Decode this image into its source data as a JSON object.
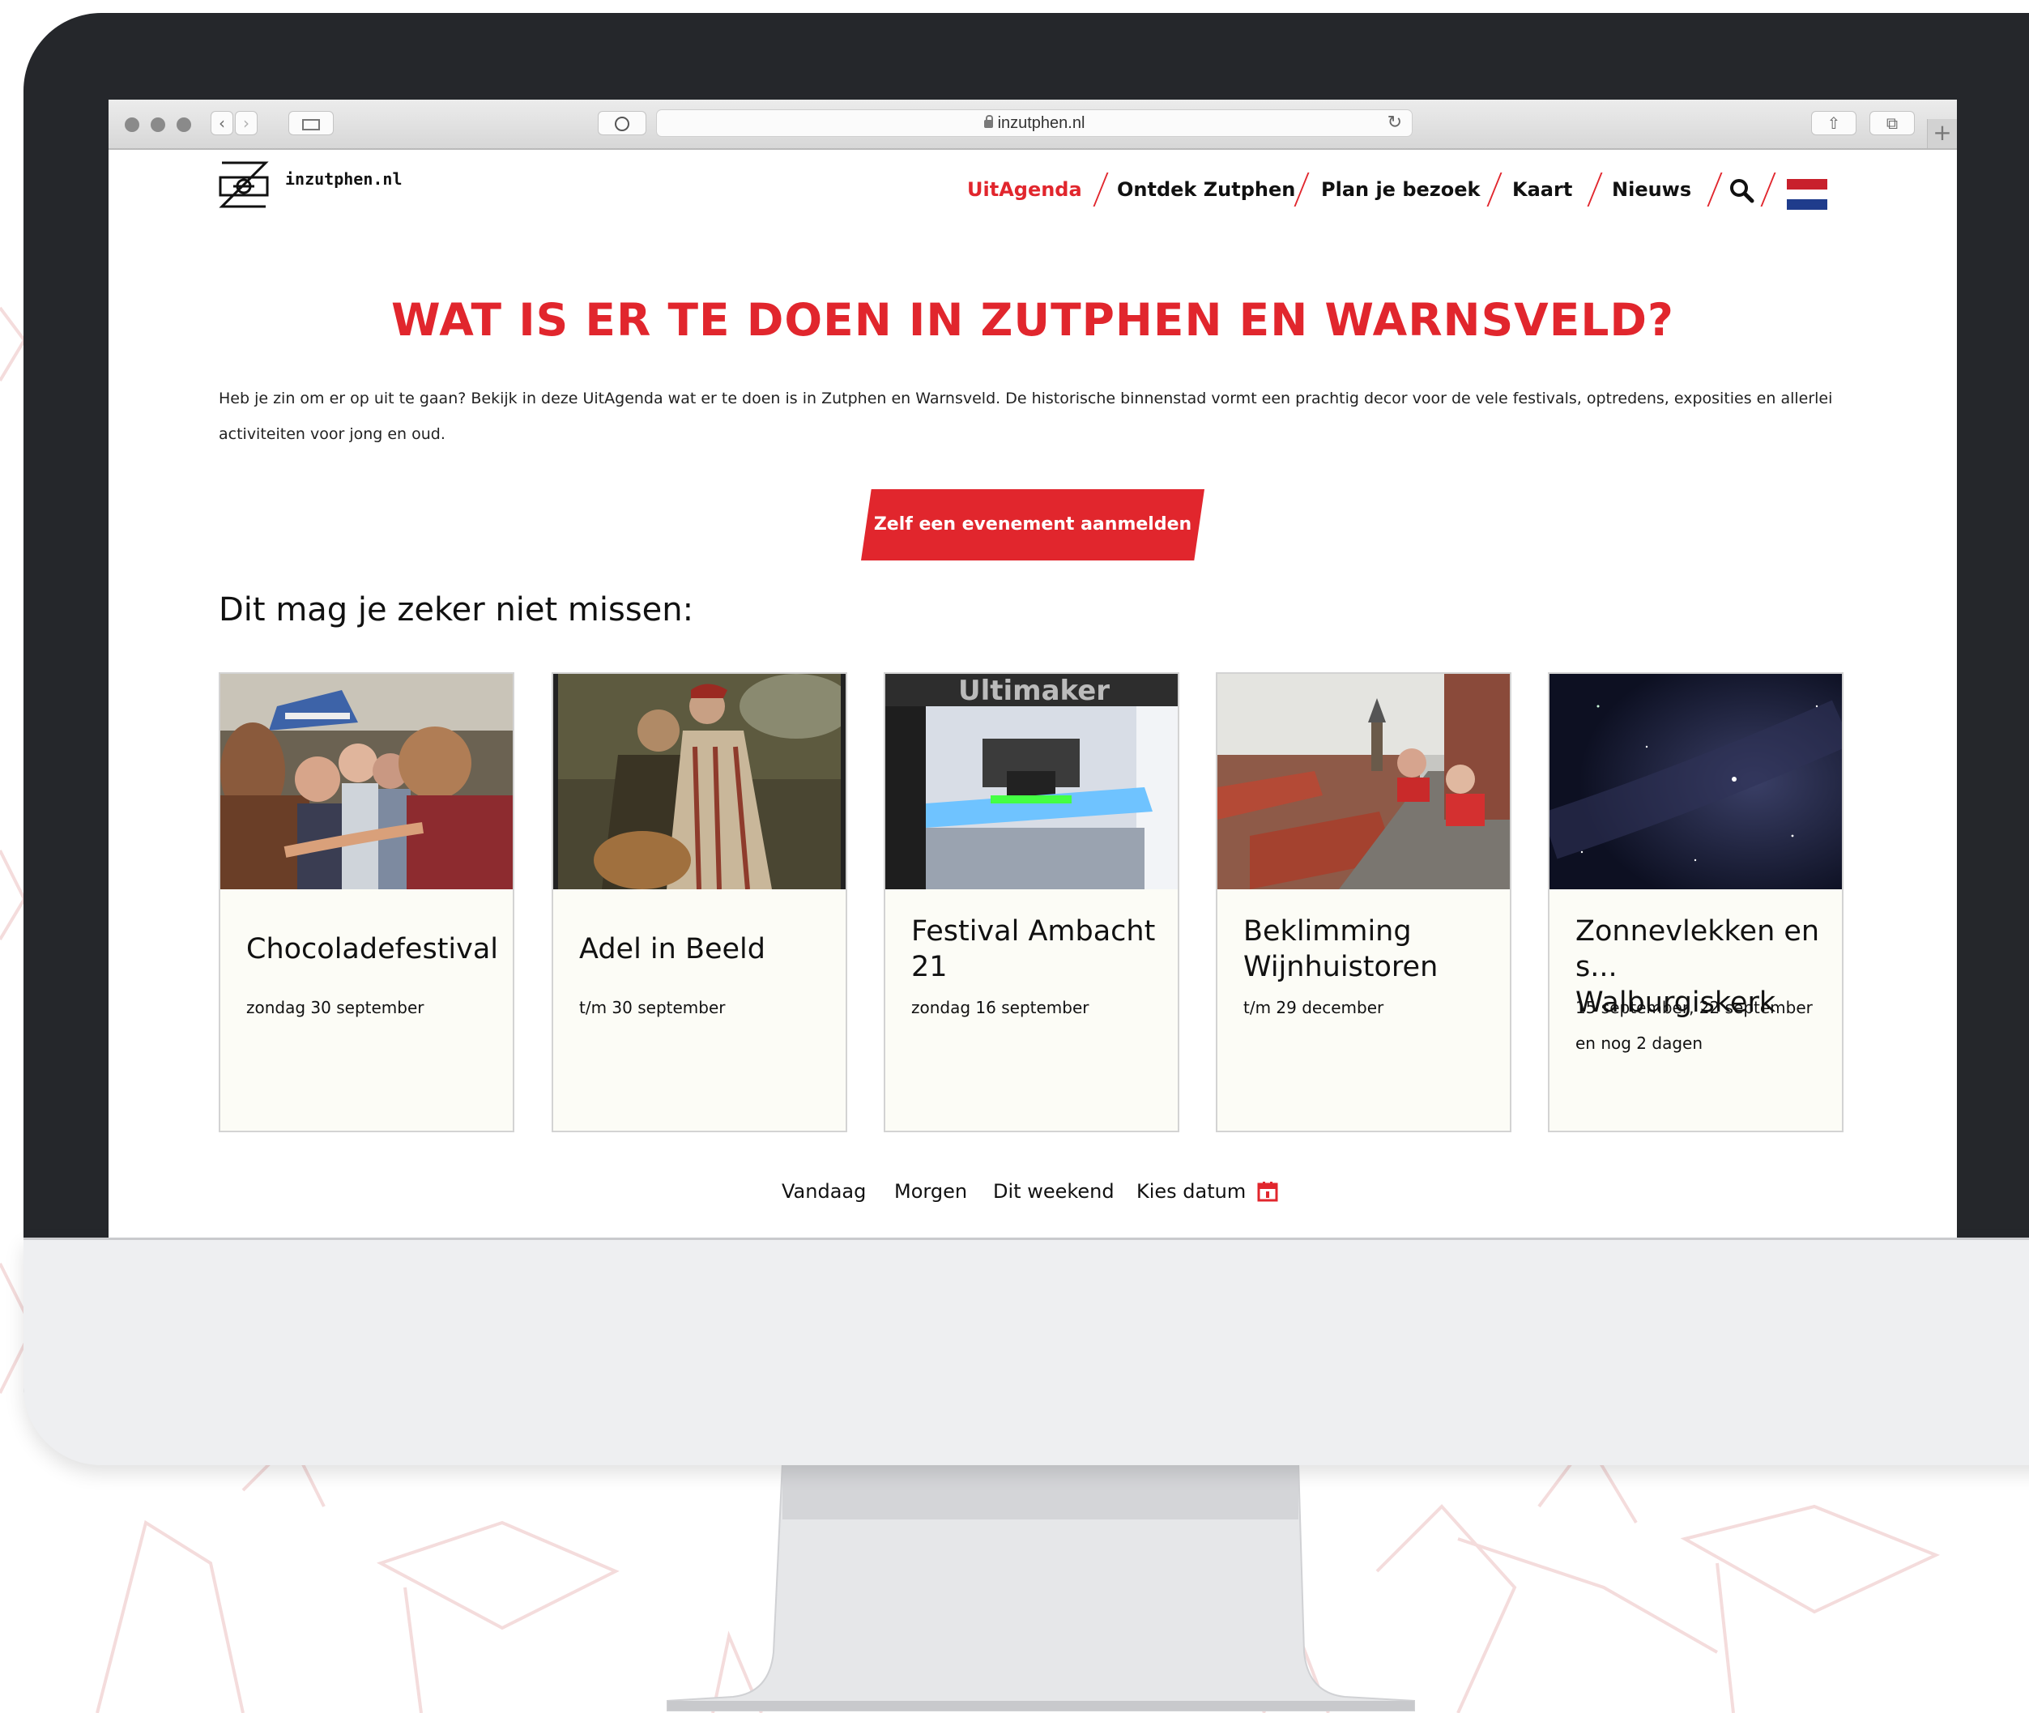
{
  "browser": {
    "url": "inzutphen.nl",
    "newtab_label": "+"
  },
  "site": {
    "logo_text": "inzutphen.nl",
    "nav": [
      {
        "label": "UitAgenda",
        "active": true
      },
      {
        "label": "Ontdek Zutphen",
        "active": false
      },
      {
        "label": "Plan je bezoek",
        "active": false
      },
      {
        "label": "Kaart",
        "active": false
      },
      {
        "label": "Nieuws",
        "active": false
      }
    ],
    "language_icon": "flag-nl-icon",
    "accent_color": "#e1262d"
  },
  "hero": {
    "title": "WAT IS ER TE DOEN IN ZUTPHEN EN WARNSVELD?",
    "intro": "Heb je zin om er op uit te gaan? Bekijk in deze UitAgenda wat er te doen is in Zutphen en Warnsveld. De historische binnenstad vormt een prachtig decor voor de vele festivals, optredens, exposities en allerlei activiteiten voor jong en oud.",
    "cta_label": "Zelf een evenement aanmelden"
  },
  "highlights": {
    "heading": "Dit mag je zeker niet missen:",
    "cards": [
      {
        "title": "Chocoladefestival",
        "date": "zondag 30 september"
      },
      {
        "title": "Adel in Beeld",
        "date": "t/m 30 september"
      },
      {
        "title": "Festival Ambacht 21",
        "date": "zondag 16 september"
      },
      {
        "title": "Beklimming Wijnhuistoren",
        "date": "t/m 29 december"
      },
      {
        "title": "Zonnevlekken en s... Walburgiskerk",
        "date": "15 september, 22 september en nog 2 dagen"
      }
    ]
  },
  "date_filter": {
    "today": "Vandaag",
    "tomorrow": "Morgen",
    "weekend": "Dit weekend",
    "pick_date": "Kies datum"
  }
}
